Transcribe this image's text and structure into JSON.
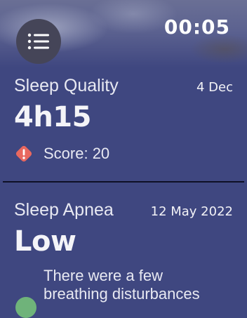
{
  "header": {
    "clock": "00:05",
    "menu_icon": "menu-list-icon"
  },
  "sleep_quality": {
    "title": "Sleep Quality",
    "date": "4 Dec",
    "value": "4h15",
    "score_label": "Score: 20",
    "score_icon": "warning-diamond-icon",
    "score_color": "#e8685f"
  },
  "sleep_apnea": {
    "title": "Sleep Apnea",
    "date": "12 May 2022",
    "value": "Low",
    "detail_line1": "There were a few",
    "detail_line2": "breathing disturbances",
    "status_color": "#6fb37a"
  },
  "colors": {
    "background": "#3f4780",
    "divider": "#0f1026"
  }
}
